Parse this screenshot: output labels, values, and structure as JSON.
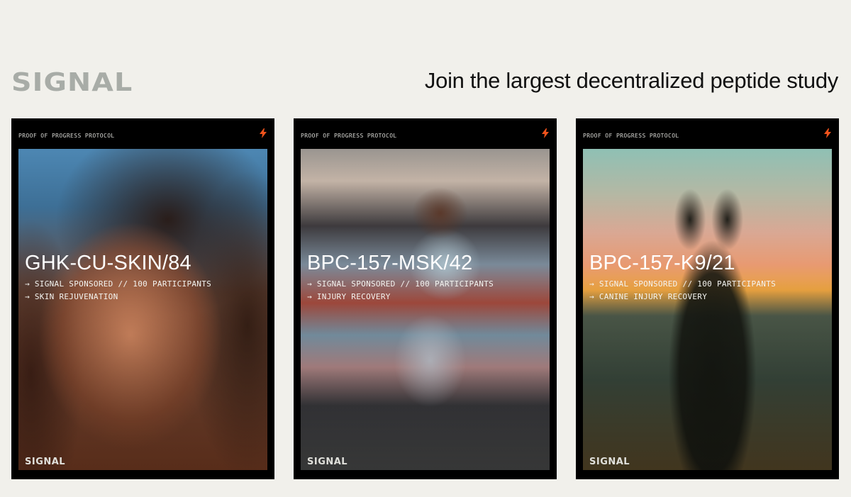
{
  "header": {
    "logo_text": "SIGNAL",
    "headline": "Join the largest decentralized peptide study"
  },
  "colors": {
    "background": "#f1f0eb",
    "logo": "#a8aca7",
    "card": "#000000",
    "accent_bolt": "#f0531c"
  },
  "cards": [
    {
      "protocol": "PROOF OF PROGRESS PROTOCOL",
      "icon": "bolt-icon",
      "code": "GHK-CU-SKIN/84",
      "line1": "→ SIGNAL SPONSORED // 100 PARTICIPANTS",
      "line2": "→ SKIN REJUVENATION",
      "footer_logo": "SIGNAL"
    },
    {
      "protocol": "PROOF OF PROGRESS PROTOCOL",
      "icon": "bolt-icon",
      "code": "BPC-157-MSK/42",
      "line1": "→ SIGNAL SPONSORED // 100 PARTICIPANTS",
      "line2": "→ INJURY RECOVERY",
      "footer_logo": "SIGNAL"
    },
    {
      "protocol": "PROOF OF PROGRESS PROTOCOL",
      "icon": "bolt-icon",
      "code": "BPC-157-K9/21",
      "line1": "→ SIGNAL SPONSORED // 100 PARTICIPANTS",
      "line2": "→ CANINE INJURY RECOVERY",
      "footer_logo": "SIGNAL"
    }
  ]
}
